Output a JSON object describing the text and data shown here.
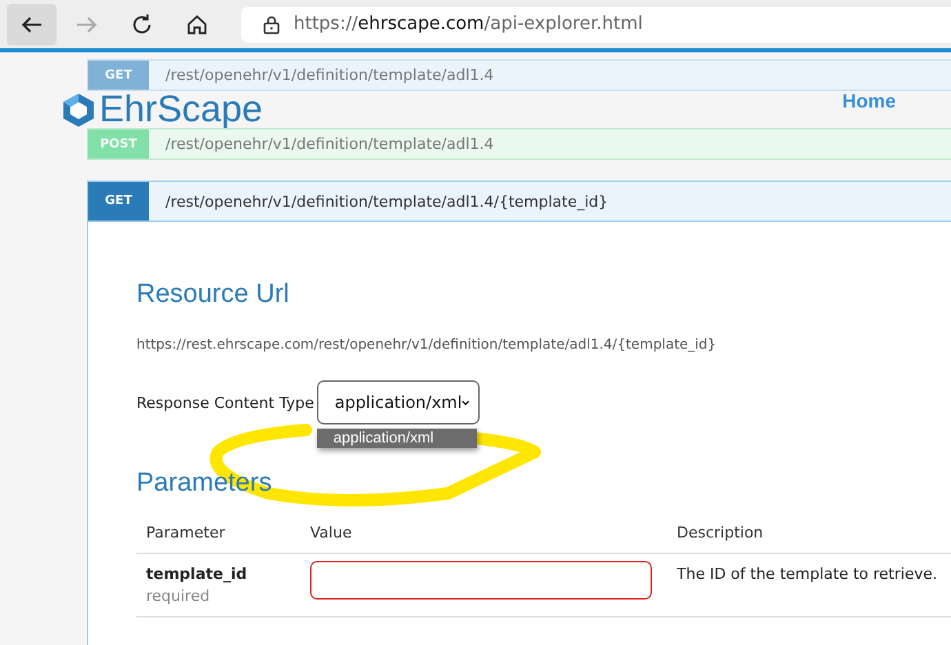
{
  "browser": {
    "url_scheme": "https://",
    "url_host": "ehrscape.com",
    "url_path": "/api-explorer.html"
  },
  "site_header": {
    "logo_text": "EhrScape",
    "nav": [
      {
        "label": "Home"
      }
    ]
  },
  "endpoints": [
    {
      "method": "GET",
      "path": "/rest/openehr/v1/definition/template/adl1.4",
      "expanded": false
    },
    {
      "method": "POST",
      "path": "/rest/openehr/v1/definition/template/adl1.4",
      "expanded": false
    },
    {
      "method": "GET",
      "path": "/rest/openehr/v1/definition/template/adl1.4/{template_id}",
      "expanded": true
    }
  ],
  "operation": {
    "resource_url_heading": "Resource Url",
    "resource_url": "https://rest.ehrscape.com/rest/openehr/v1/definition/template/adl1.4/{template_id}",
    "response_content_type": {
      "label": "Response Content Type",
      "value": "application/xml",
      "expanded": true,
      "options": [
        {
          "label": "application/xml",
          "selected": true
        }
      ]
    },
    "parameters_heading": "Parameters",
    "parameters": {
      "columns": [
        "Parameter",
        "Value",
        "Description"
      ],
      "rows": [
        {
          "name": "template_id",
          "requirement": "required",
          "invalid": true,
          "description": "The ID of the template to retrieve."
        }
      ]
    }
  }
}
